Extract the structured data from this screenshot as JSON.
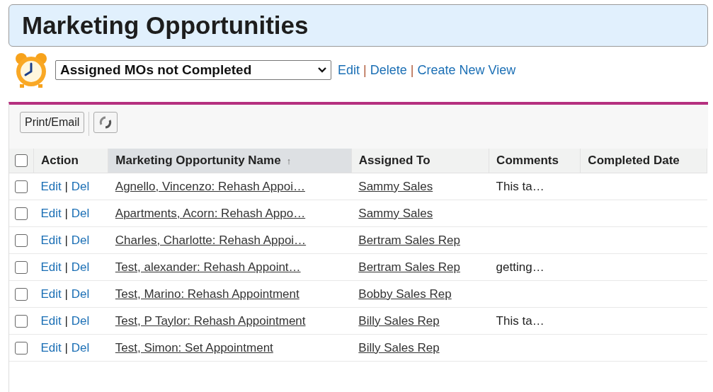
{
  "header": {
    "title": "Marketing Opportunities"
  },
  "view": {
    "selected_view": "Assigned MOs not Completed",
    "links": [
      "Edit",
      "Delete",
      "Create New View"
    ],
    "separators": [
      "|",
      "|"
    ]
  },
  "toolbar": {
    "print_button": "Print/Email"
  },
  "table": {
    "select_all_checked": false,
    "columns": [
      {
        "label": "Action",
        "sorted": false
      },
      {
        "label": "Marketing Opportunity Name",
        "sorted": true,
        "sort_icon": "↑"
      },
      {
        "label": "Assigned To",
        "sorted": false
      },
      {
        "label": "Comments",
        "sorted": false
      },
      {
        "label": "Completed Date",
        "sorted": false
      }
    ],
    "rows": [
      {
        "checked": false,
        "edit": "Edit",
        "separator": "|",
        "del": "Del",
        "name": "Agnello, Vincenzo: Rehash Appoi…",
        "assigned_to": "Sammy Sales",
        "comments": "This ta…"
      },
      {
        "checked": false,
        "edit": "Edit",
        "separator": "|",
        "del": "Del",
        "name": "Apartments, Acorn: Rehash Appo…",
        "assigned_to": "Sammy Sales"
      },
      {
        "checked": false,
        "edit": "Edit",
        "separator": "|",
        "del": "Del",
        "name": "Charles, Charlotte: Rehash Appoi…",
        "assigned_to": "Bertram Sales Rep"
      },
      {
        "checked": false,
        "edit": "Edit",
        "separator": "|",
        "del": "Del",
        "name": "Test, alexander: Rehash Appoint…",
        "assigned_to": "Bertram Sales Rep",
        "comments": "getting…"
      },
      {
        "checked": false,
        "edit": "Edit",
        "separator": "|",
        "del": "Del",
        "name": "Test, Marino: Rehash Appointment",
        "assigned_to": "Bobby Sales Rep"
      },
      {
        "checked": false,
        "edit": "Edit",
        "separator": "|",
        "del": "Del",
        "name": "Test, P Taylor: Rehash Appointment",
        "assigned_to": "Billy Sales Rep",
        "comments": "This ta…"
      },
      {
        "checked": false,
        "edit": "Edit",
        "separator": "|",
        "del": "Del",
        "name": "Test, Simon: Set Appointment",
        "assigned_to": "Billy Sales Rep"
      }
    ]
  }
}
